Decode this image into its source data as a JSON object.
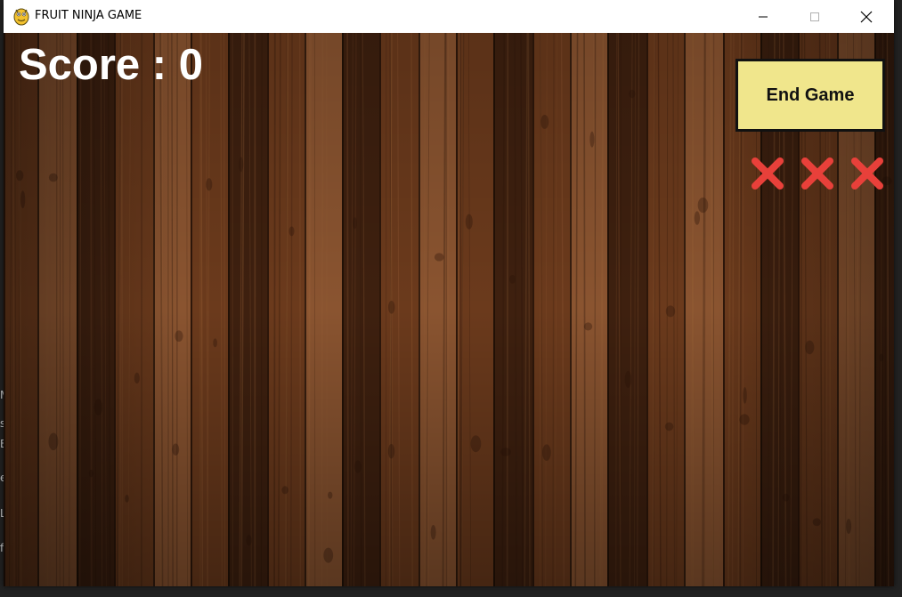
{
  "window": {
    "title": "FRUIT NINJA GAME",
    "icons": {
      "app": "pygame-snake-icon",
      "minimize": "minimize-icon",
      "maximize": "maximize-icon",
      "close": "close-icon"
    }
  },
  "background_peek": [
    "M",
    "s",
    "E",
    "e",
    "L",
    "f"
  ],
  "game": {
    "score_text": "Score : 0",
    "score_value": 0,
    "end_button_label": "End Game",
    "lives_lost": 3,
    "lives_icon": "red-x-icon",
    "background": "wooden-planks",
    "colors": {
      "button_bg": "#f0e68c",
      "button_border": "#111111",
      "life_x": "#e8403a",
      "score_text": "#ffffff",
      "wood_dark": "#3e200f",
      "wood_mid": "#6b3a1c",
      "wood_light": "#8a5430"
    }
  }
}
